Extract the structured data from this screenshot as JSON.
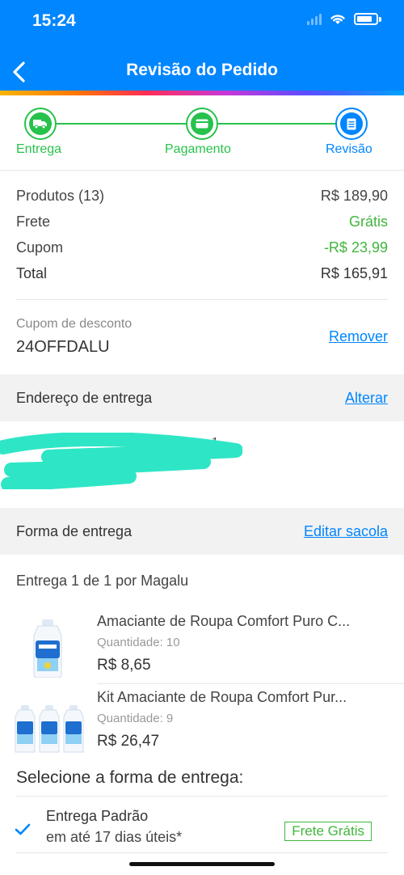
{
  "status_bar": {
    "time": "15:24"
  },
  "header": {
    "title": "Revisão do Pedido"
  },
  "stepper": {
    "steps": [
      {
        "label": "Entrega",
        "icon": "truck-icon",
        "state": "done"
      },
      {
        "label": "Pagamento",
        "icon": "credit-card-icon",
        "state": "done"
      },
      {
        "label": "Revisão",
        "icon": "document-icon",
        "state": "current"
      }
    ]
  },
  "summary": {
    "products_label": "Produtos (13)",
    "products_value": "R$ 189,90",
    "shipping_label": "Frete",
    "shipping_value": "Grátis",
    "coupon_label": "Cupom",
    "coupon_value": "-R$ 23,99",
    "total_label": "Total",
    "total_value": "R$ 165,91"
  },
  "coupon": {
    "caption": "Cupom de desconto",
    "code": "24OFFDALU",
    "remove_label": "Remover"
  },
  "address": {
    "title": "Endereço de entrega",
    "change_label": "Alterar",
    "visible_fragment_1": "1",
    "visible_fragment_2": ",SC",
    "visible_fragment_3": ""
  },
  "delivery": {
    "title": "Forma de entrega",
    "edit_label": "Editar sacola",
    "shipment_label": "Entrega 1 de 1",
    "seller_label": "por Magalu",
    "products": [
      {
        "name": "Amaciante de Roupa Comfort Puro C...",
        "quantity": "Quantidade: 10",
        "price": "R$ 8,65",
        "image": "single-bottle"
      },
      {
        "name": "Kit Amaciante de Roupa Comfort Pur...",
        "quantity": "Quantidade: 9",
        "price": "R$ 26,47",
        "image": "three-bottles"
      }
    ],
    "select_title": "Selecione a forma de entrega:",
    "option": {
      "name": "Entrega Padrão",
      "eta": "em até 17 dias úteis*",
      "badge": "Frete Grátis",
      "selected": true
    }
  },
  "colors": {
    "primary": "#0086ff",
    "success": "#27c24c",
    "price_green": "#41b63b",
    "redaction": "#2ee6c6"
  }
}
